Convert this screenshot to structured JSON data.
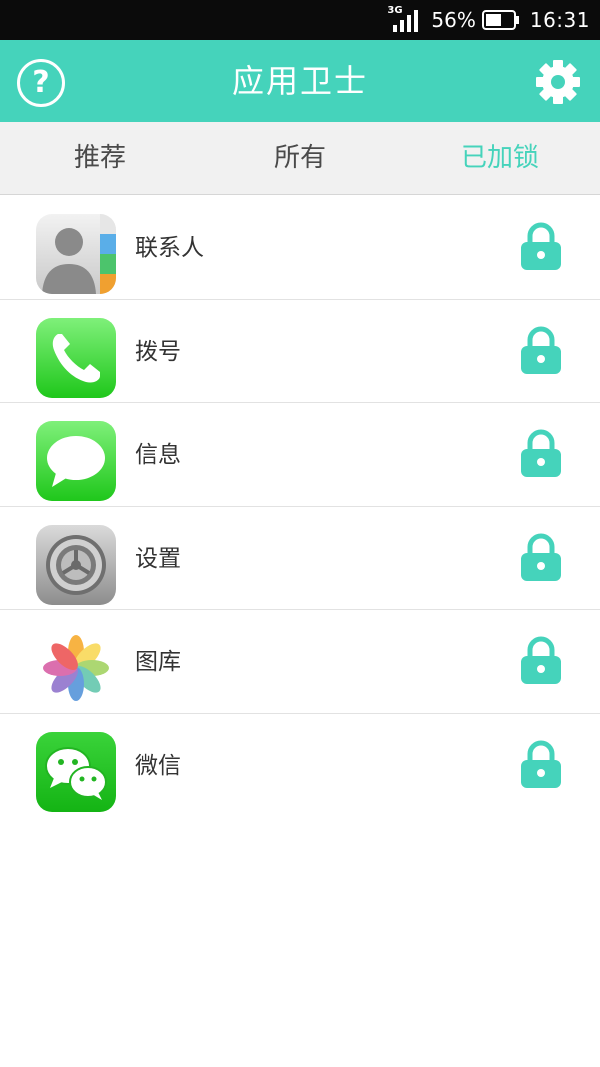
{
  "status_bar": {
    "network": "3G",
    "battery_percent": "56%",
    "time": "16:31",
    "icons": [
      "signal-icon",
      "battery-icon"
    ]
  },
  "header": {
    "title": "应用卫士",
    "help_icon": "question-circle-icon",
    "settings_icon": "gear-icon",
    "background_color": "#45d3bb"
  },
  "tabs": [
    {
      "label": "推荐",
      "active": false
    },
    {
      "label": "所有",
      "active": false
    },
    {
      "label": "已加锁",
      "active": true
    }
  ],
  "apps": [
    {
      "name": "联系人",
      "icon": "contacts-icon",
      "locked": true
    },
    {
      "name": "拨号",
      "icon": "phone-icon",
      "locked": true
    },
    {
      "name": "信息",
      "icon": "messages-icon",
      "locked": true
    },
    {
      "name": "设置",
      "icon": "settings-app-icon",
      "locked": true
    },
    {
      "name": "图库",
      "icon": "photos-icon",
      "locked": true
    },
    {
      "name": "微信",
      "icon": "wechat-icon",
      "locked": true
    }
  ],
  "colors": {
    "accent": "#45d3bb",
    "tab_background": "#f1f1f1",
    "text": "#333333"
  }
}
